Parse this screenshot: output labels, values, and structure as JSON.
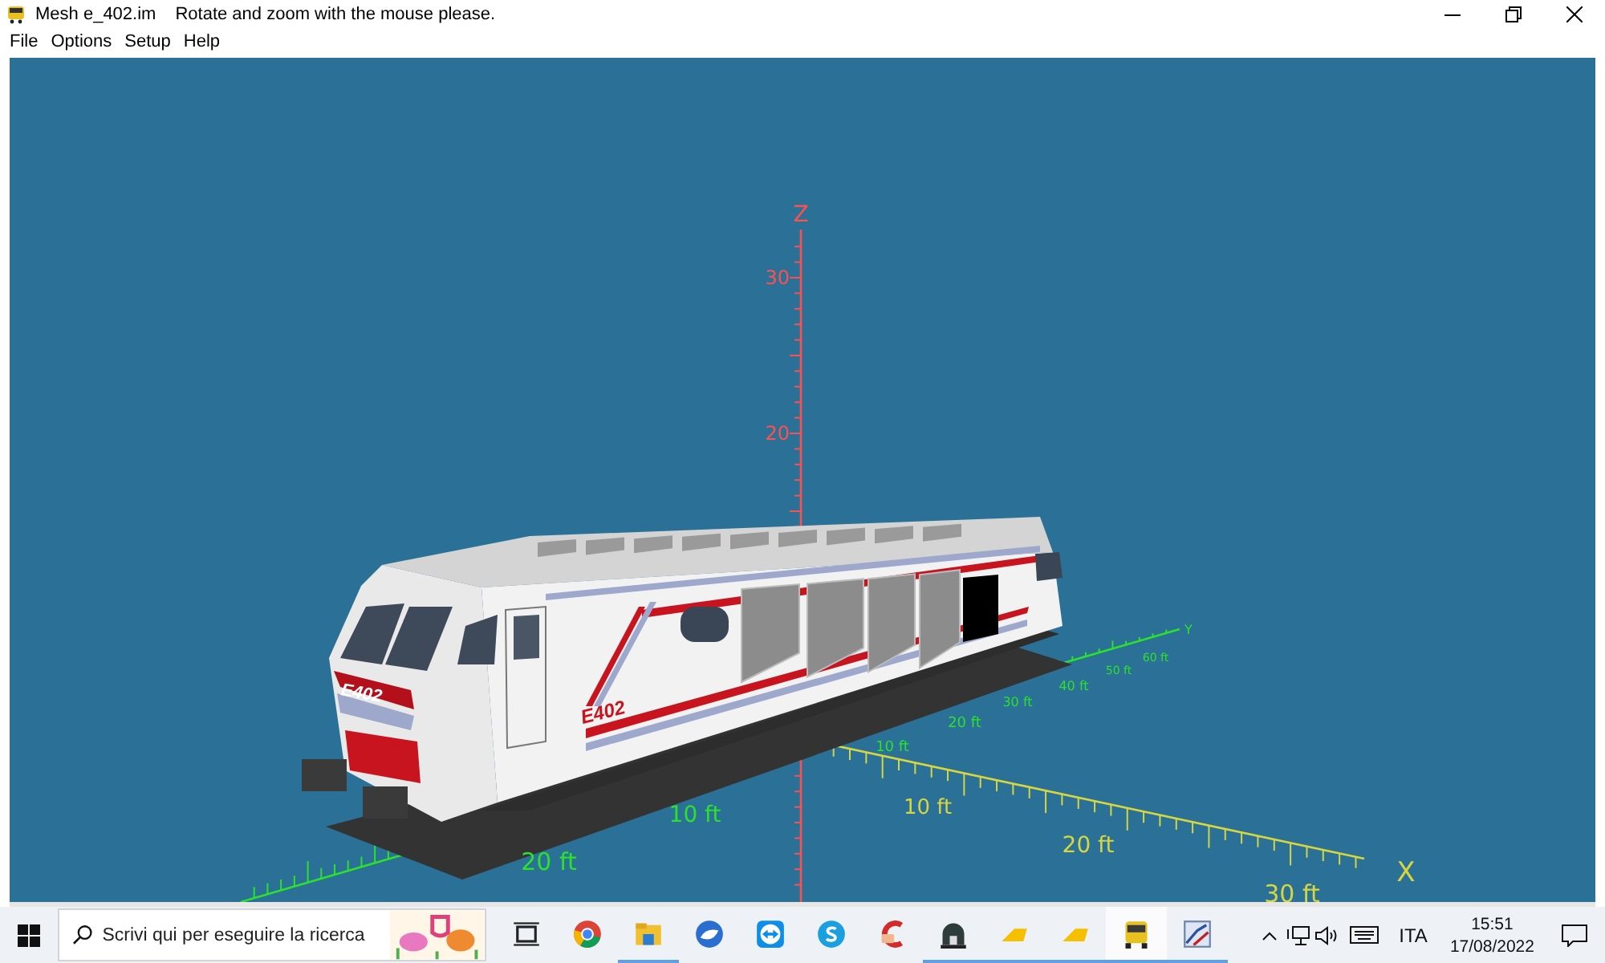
{
  "window": {
    "title": "Mesh e_402.im",
    "message": "Rotate and zoom with the mouse please."
  },
  "menu": [
    "File",
    "Options",
    "Setup",
    "Help"
  ],
  "viewport": {
    "axes": [
      {
        "kind": "z",
        "color": "#ff5050",
        "name": "Z",
        "labels": [
          "30",
          "20"
        ]
      },
      {
        "kind": "x",
        "color": "#d6d640",
        "name": "X",
        "labels": [
          "10 ft",
          "20 ft",
          "30 ft"
        ]
      },
      {
        "kind": "y",
        "color": "#2ee02e",
        "name": "Y",
        "labels": [
          "20 ft",
          "10 ft",
          "10 ft",
          "20 ft",
          "30 ft",
          "40 ft",
          "50 ft",
          "60 ft"
        ]
      }
    ],
    "model": {
      "markings": [
        "E402",
        "E402"
      ]
    }
  },
  "taskbar": {
    "search": {
      "placeholder": "Scrivi qui per eseguire la ricerca"
    },
    "apps": [
      {
        "running": false,
        "selected": false
      },
      {
        "running": false,
        "selected": false
      },
      {
        "running": true,
        "selected": false
      },
      {
        "running": false,
        "selected": false
      },
      {
        "running": false,
        "selected": false
      },
      {
        "running": false,
        "selected": false
      },
      {
        "running": false,
        "selected": false
      },
      {
        "running": true,
        "selected": false
      },
      {
        "running": true,
        "selected": false
      },
      {
        "running": true,
        "selected": false
      },
      {
        "running": true,
        "selected": true
      },
      {
        "running": true,
        "selected": false
      }
    ],
    "language": "ITA",
    "time": "15:51",
    "date": "17/08/2022"
  }
}
